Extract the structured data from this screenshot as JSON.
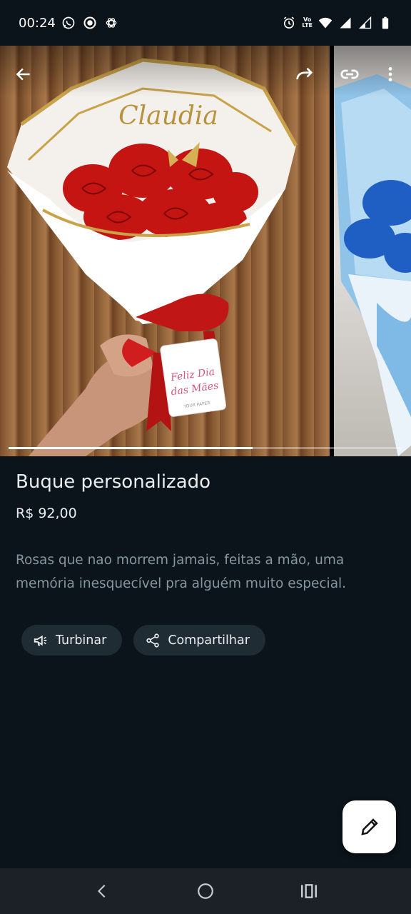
{
  "status_bar": {
    "time": "00:24",
    "left_icons": [
      "whatsapp-icon",
      "record-icon",
      "openai-icon"
    ],
    "right_icons": [
      "alarm-icon",
      "volte-icon",
      "wifi-icon",
      "signal-icon",
      "signal-icon",
      "battery-icon"
    ],
    "lte_top": "Vo",
    "lte_bottom": "LTE"
  },
  "carousel": {
    "progress": 0.62,
    "photo_text": {
      "name": "Claudia",
      "tag_line1": "Feliz Dia",
      "tag_line2": "das Mães",
      "tag_brand": "YOUR PAPER"
    },
    "toolbar_icons": [
      "back-arrow-icon",
      "forward-icon",
      "link-icon",
      "more-vert-icon"
    ]
  },
  "product": {
    "title": "Buque personalizado",
    "price": "R$ 92,00",
    "description": "Rosas que nao morrem jamais, feitas a mão,  uma memória inesquecível pra alguém muito especial."
  },
  "actions": {
    "boost_label": "Turbinar",
    "share_label": "Compartilhar"
  },
  "fab": {
    "icon": "edit-pencil-icon"
  },
  "nav_bar": {
    "icons": [
      "back-icon",
      "home-icon",
      "recents-icon"
    ]
  },
  "colors": {
    "background": "#0b141a",
    "chip": "#202c33",
    "text_primary": "#e9edef",
    "text_secondary": "#8696a0"
  }
}
